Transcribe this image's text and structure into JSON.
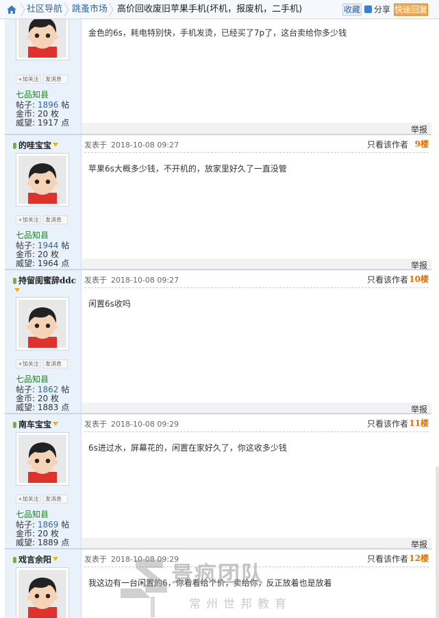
{
  "breadcrumb": {
    "items": [
      "社区导航",
      "跳蚤市场"
    ],
    "title": "高价回收废旧苹果手机(坏机，报废机，二手机)"
  },
  "toolbar": {
    "favorite": "收藏",
    "share": "分享",
    "quick_reply": "快速回复"
  },
  "labels": {
    "posted_at": "发表于",
    "only_author": "只看该作者",
    "report": "举报",
    "follow": "+加关注",
    "message": "发消息",
    "posts": "帖子:",
    "posts_unit": "帖",
    "coins": "金币:",
    "coins_unit": "枚",
    "prestige": "威望:",
    "prestige_unit": "点"
  },
  "posts": [
    {
      "level": "七品知县",
      "posts": "1896",
      "coins": "20",
      "prestige": "1917",
      "content": "金色的6s，耗电特别快，手机发烫，已经买了7p了，这台卖给你多少钱"
    },
    {
      "user": "的哇宝宝",
      "date": "2018-10-08  09:27",
      "floor": "9楼",
      "level": "七品知县",
      "posts": "1944",
      "coins": "20",
      "prestige": "1964",
      "content": "苹果6s大概多少钱，不开机的，放家里好久了一直没管"
    },
    {
      "user": "持留闺蜜辞ddc",
      "date": "2018-10-08  09:27",
      "floor": "10楼",
      "level": "七品知县",
      "posts": "1862",
      "coins": "20",
      "prestige": "1883",
      "content": "闲置6s收吗"
    },
    {
      "user": "南车宝宝",
      "date": "2018-10-08  09:29",
      "floor": "11楼",
      "level": "七品知县",
      "posts": "1869",
      "coins": "20",
      "prestige": "1889",
      "content": "6s进过水，屏幕花的，闲置在家好久了，你这收多少钱"
    },
    {
      "user": "戏言余阳",
      "date": "2018-10-08  09:29",
      "floor": "12楼",
      "content": "我这边有一台闲置的6，你看看给个价，卖给你，反正放着也是放着"
    }
  ],
  "watermark": {
    "title": "景疯团队",
    "subtitle": "常州世邦教育"
  },
  "icons": [
    "home-icon",
    "share-icon",
    "avatar-image",
    "online-icon",
    "gender-icon"
  ],
  "colors": {
    "accent": "#336699",
    "floor": "#e07000",
    "level": "#1a8a1a",
    "quick_reply": "#f6a84a",
    "sidebar": "#e9f1fb"
  }
}
